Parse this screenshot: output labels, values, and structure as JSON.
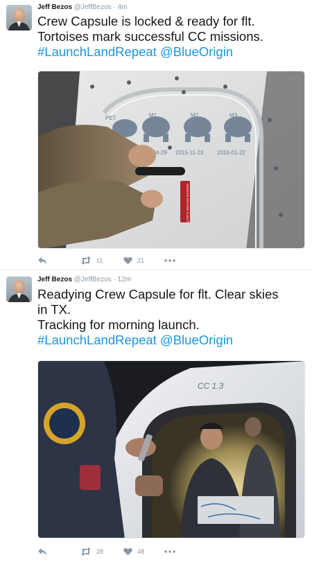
{
  "tweets": [
    {
      "author": {
        "name": "Jeff Bezos",
        "handle": "@JeffBezos"
      },
      "separator": "·",
      "time": "4m",
      "lines": [
        {
          "text": "Crew Capsule is locked & ready for flt."
        },
        {
          "text": "Tortoises mark successful CC missions."
        }
      ],
      "hashtag": "#LaunchLandRepeat",
      "mention": "@BlueOrigin",
      "media": {
        "mission_labels": [
          "PET",
          "M1",
          "M2",
          "M3"
        ],
        "mission_dates": [
          "2015-04-29",
          "2015-11-23",
          "2016-01-22"
        ],
        "tag_text": "REMOVE BEFORE FLIGHT"
      },
      "actions": {
        "reply_icon": "reply-icon",
        "retweet_icon": "retweet-icon",
        "retweets": "11",
        "like_icon": "heart-icon",
        "likes": "21",
        "more_icon": "more-icon"
      }
    },
    {
      "author": {
        "name": "Jeff Bezos",
        "handle": "@JeffBezos"
      },
      "separator": "·",
      "time": "12m",
      "lines": [
        {
          "text": "Readying Crew Capsule for flt. Clear skies"
        },
        {
          "text": "in TX."
        },
        {
          "text": "Tracking for morning launch."
        }
      ],
      "hashtag": "#LaunchLandRepeat",
      "mention": "@BlueOrigin",
      "media": {
        "capsule_label": "CC 1.3"
      },
      "actions": {
        "reply_icon": "reply-icon",
        "retweet_icon": "retweet-icon",
        "retweets": "28",
        "like_icon": "heart-icon",
        "likes": "48",
        "more_icon": "more-icon"
      }
    }
  ],
  "colors": {
    "link": "#1b95e0",
    "meta": "#8899a6",
    "text": "#14171a",
    "divider": "#e1e8ed"
  }
}
